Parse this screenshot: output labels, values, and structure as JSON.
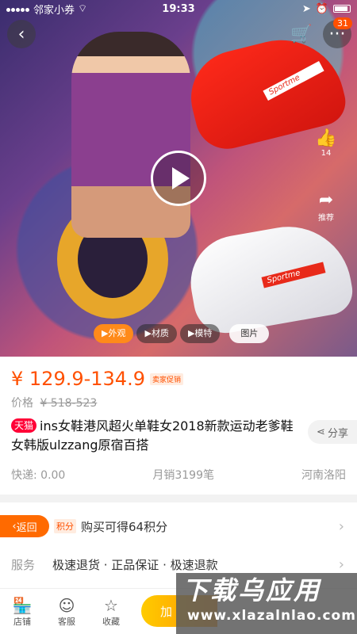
{
  "status_bar": {
    "carrier": "邻家小券",
    "time": "19:33"
  },
  "hero": {
    "cart_badge": "31",
    "like_count": "14",
    "share_label": "推荐",
    "shoe_red_text": "Sportme",
    "shoe_white_text": "Sportme",
    "media_tabs": [
      "外观",
      "材质",
      "模特",
      "图片"
    ],
    "active_media_tab": "外观"
  },
  "product": {
    "price": "¥ 129.9-134.9",
    "price_tag": "卖家促销",
    "orig_label": "价格",
    "orig_price": "¥ 518-523",
    "tmall_tag": "天猫",
    "title": "ins女鞋港风超火单鞋女2018新款运动老爹鞋女韩版ulzzang原宿百搭",
    "share_label": "分享",
    "shipping": "快递: 0.00",
    "monthly_sales": "月销3199笔",
    "location": "河南洛阳"
  },
  "points": {
    "return_label": "返回",
    "tag": "积分",
    "text": "购买可得64积分"
  },
  "service": {
    "label": "服务",
    "text": "极速退货 · 正品保证 · 极速退款"
  },
  "bottom_bar": {
    "store": "店铺",
    "service": "客服",
    "favorite": "收藏",
    "add_to_cart": "加"
  },
  "watermark": {
    "main": "下载乌应用",
    "url": "www.xlazalnlao.com"
  }
}
